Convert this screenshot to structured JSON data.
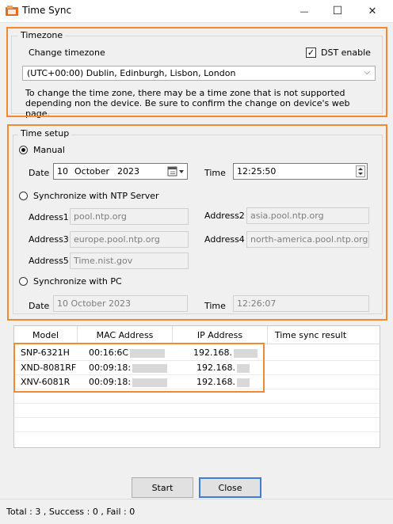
{
  "window": {
    "title": "Time Sync",
    "minimize_glyph": "—",
    "maximize_glyph": "☐",
    "close_glyph": "✕"
  },
  "timezone": {
    "group_title": "Timezone",
    "change_label": "Change timezone",
    "dst_label": "DST enable",
    "dst_checked": true,
    "selected": "(UTC+00:00) Dublin, Edinburgh, Lisbon, London",
    "note": "To change the time zone, there may be a time zone that is not supported depending non the device. Be sure to confirm the change on device's web page."
  },
  "time_setup": {
    "group_title": "Time setup",
    "manual": {
      "label": "Manual",
      "selected": true,
      "date_label": "Date",
      "date_day": "10",
      "date_month": "October",
      "date_year": "2023",
      "time_label": "Time",
      "time_value": "12:25:50"
    },
    "ntp": {
      "label": "Synchronize with NTP Server",
      "selected": false,
      "address1_label": "Address1",
      "address1_value": "pool.ntp.org",
      "address2_label": "Address2",
      "address2_value": "asia.pool.ntp.org",
      "address3_label": "Address3",
      "address3_value": "europe.pool.ntp.org",
      "address4_label": "Address4",
      "address4_value": "north-america.pool.ntp.org",
      "address5_label": "Address5",
      "address5_value": "Time.nist.gov"
    },
    "pc": {
      "label": "Synchronize with PC",
      "selected": false,
      "date_label": "Date",
      "date_value": "10 October 2023",
      "time_label": "Time",
      "time_value": "12:26:07"
    }
  },
  "device_table": {
    "columns": [
      "Model",
      "MAC Address",
      "IP Address",
      "Time sync result"
    ],
    "rows": [
      {
        "model": "SNP-6321H",
        "mac": "00:16:6C",
        "ip": "192.168.",
        "result": ""
      },
      {
        "model": "XND-8081RF",
        "mac": "00:09:18:",
        "ip": "192.168.",
        "result": ""
      },
      {
        "model": "XNV-6081R",
        "mac": "00:09:18:",
        "ip": "192.168.",
        "result": ""
      }
    ]
  },
  "buttons": {
    "start": "Start",
    "close": "Close"
  },
  "status": {
    "text": "Total : 3 , Success : 0 , Fail : 0"
  },
  "colors": {
    "highlight": "#f08a30",
    "default_button_border": "#3c7fd1"
  }
}
